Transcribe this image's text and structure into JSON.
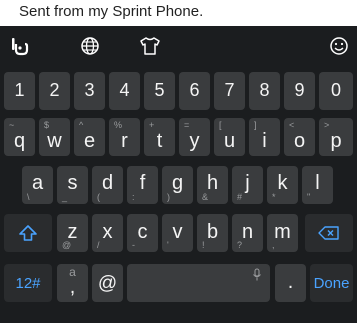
{
  "compose": {
    "text": "Sent from my Sprint Phone."
  },
  "toolbar": {
    "icons": [
      "swype-logo-icon",
      "globe-icon",
      "theme-shirt-icon",
      "emoji-icon"
    ]
  },
  "number_row": [
    "1",
    "2",
    "3",
    "4",
    "5",
    "6",
    "7",
    "8",
    "9",
    "0"
  ],
  "row_q": [
    {
      "key": "q",
      "hint": "~"
    },
    {
      "key": "w",
      "hint": "$"
    },
    {
      "key": "e",
      "hint": "^"
    },
    {
      "key": "r",
      "hint": "%"
    },
    {
      "key": "t",
      "hint": "+"
    },
    {
      "key": "y",
      "hint": "="
    },
    {
      "key": "u",
      "hint": "["
    },
    {
      "key": "i",
      "hint": "]"
    },
    {
      "key": "o",
      "hint": "<"
    },
    {
      "key": "p",
      "hint": ">"
    }
  ],
  "row_a": [
    {
      "key": "a",
      "hint": "\\"
    },
    {
      "key": "s",
      "hint": "_"
    },
    {
      "key": "d",
      "hint": "("
    },
    {
      "key": "f",
      "hint": ":"
    },
    {
      "key": "g",
      "hint": ")"
    },
    {
      "key": "h",
      "hint": "&"
    },
    {
      "key": "j",
      "hint": "#"
    },
    {
      "key": "k",
      "hint": "*"
    },
    {
      "key": "l",
      "hint": "\""
    }
  ],
  "row_z": [
    {
      "key": "z",
      "hint": "@"
    },
    {
      "key": "x",
      "hint": "/"
    },
    {
      "key": "c",
      "hint": "-"
    },
    {
      "key": "v",
      "hint": "'"
    },
    {
      "key": "b",
      "hint": "!"
    },
    {
      "key": "n",
      "hint": "?"
    },
    {
      "key": "m",
      "hint": ","
    }
  ],
  "bottom_row": {
    "symbols_label": "12#",
    "comma_key": ",",
    "comma_hint": "a",
    "at_key": "@",
    "period_key": ".",
    "done_label": "Done"
  },
  "colors": {
    "keyboard_bg": "#1b1d1f",
    "key_bg": "#3a3c3e",
    "accent": "#4aa3ff"
  }
}
